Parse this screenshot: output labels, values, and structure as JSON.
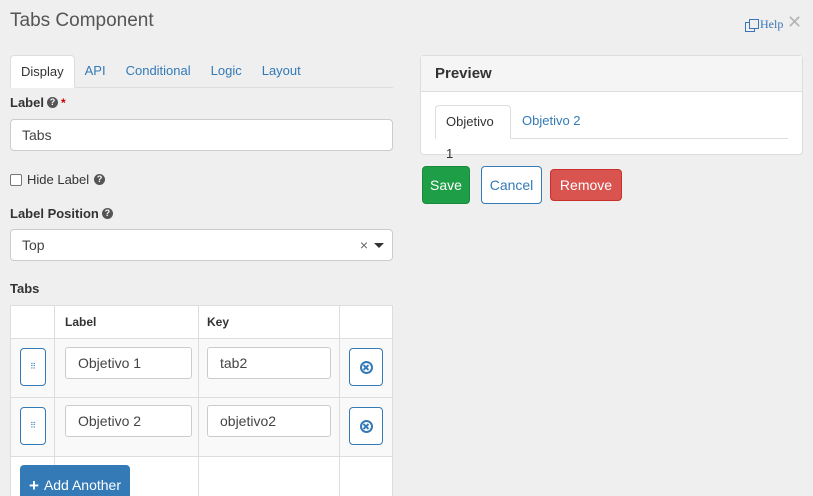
{
  "dialog": {
    "title": "Tabs Component",
    "help_label": "Help",
    "close_glyph": "✕"
  },
  "editor_tabs": [
    "Display",
    "API",
    "Conditional",
    "Logic",
    "Layout"
  ],
  "form": {
    "label": {
      "label": "Label",
      "required_mark": "*",
      "value": "Tabs"
    },
    "hide_label": {
      "label": "Hide Label",
      "checked": false
    },
    "label_position": {
      "label": "Label Position",
      "value": "Top",
      "clear_glyph": "×"
    },
    "help_glyph": "?"
  },
  "tabs_table": {
    "title": "Tabs",
    "columns": [
      "Label",
      "Key"
    ],
    "rows": [
      {
        "label": "Objetivo 1",
        "key": "tab2"
      },
      {
        "label": "Objetivo 2",
        "key": "objetivo2"
      }
    ],
    "drag_glyph": "⠿",
    "add_button": {
      "icon": "plus-icon",
      "glyph": "+",
      "label": "Add Another"
    }
  },
  "preview": {
    "title": "Preview",
    "tabs": [
      "Objetivo 1",
      "Objetivo 2"
    ],
    "active_tab": "Objetivo 1"
  },
  "actions": {
    "save": "Save",
    "cancel": "Cancel",
    "remove": "Remove"
  },
  "colors": {
    "primary": "#337ab7",
    "save": "#1e9e46",
    "remove": "#d9534f",
    "background": "#efefef"
  }
}
